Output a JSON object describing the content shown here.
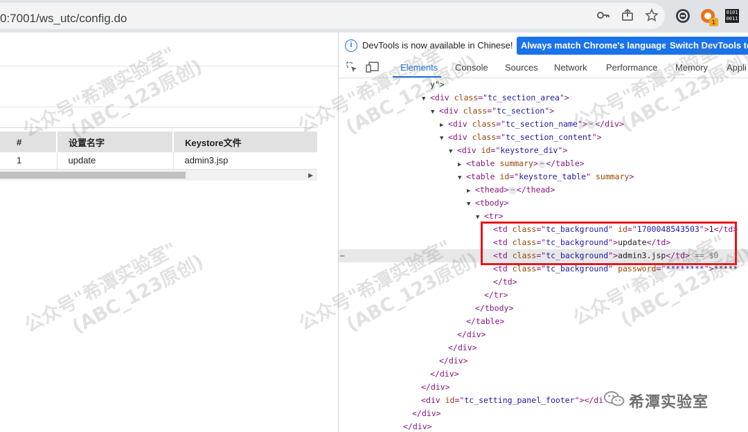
{
  "browser": {
    "url": "0:7001/ws_utc/config.do",
    "extension_badge": "1",
    "extension_binary_text": "0101 0011"
  },
  "page": {
    "table": {
      "headers": [
        "#",
        "设置名字",
        "Keystore文件"
      ],
      "rows": [
        [
          "1",
          "update",
          "admin3.jsp"
        ]
      ]
    },
    "scroll_arrow": "▶"
  },
  "devtools": {
    "infobar": {
      "text": "DevTools is now available in Chinese!",
      "match_button": "Always match Chrome's language",
      "switch_button": "Switch DevTools to"
    },
    "tabs": [
      "Elements",
      "Console",
      "Sources",
      "Network",
      "Performance",
      "Memory",
      "Appli"
    ],
    "active_tab": "Elements",
    "row_more": "⋯",
    "dom_lines": [
      {
        "indent": 0,
        "tri": "",
        "parts": [
          [
            "tx",
            "y\">"
          ]
        ]
      },
      {
        "indent": 0,
        "tri": "▼",
        "parts": [
          [
            "tg",
            "<div "
          ],
          [
            "an",
            "class"
          ],
          [
            "tg",
            "=\""
          ],
          [
            "av",
            "tc_section_area"
          ],
          [
            "tg",
            "\">"
          ]
        ]
      },
      {
        "indent": 1,
        "tri": "▼",
        "parts": [
          [
            "tg",
            "<div "
          ],
          [
            "an",
            "class"
          ],
          [
            "tg",
            "=\""
          ],
          [
            "av",
            "tc_section"
          ],
          [
            "tg",
            "\">"
          ]
        ]
      },
      {
        "indent": 2,
        "tri": "▶",
        "parts": [
          [
            "tg",
            "<div "
          ],
          [
            "an",
            "class"
          ],
          [
            "tg",
            "=\""
          ],
          [
            "av",
            "tc_section_name"
          ],
          [
            "tg",
            "\">"
          ],
          [
            "ell",
            "⋯"
          ],
          [
            "tg",
            "</div>"
          ]
        ]
      },
      {
        "indent": 2,
        "tri": "▼",
        "parts": [
          [
            "tg",
            "<div "
          ],
          [
            "an",
            "class"
          ],
          [
            "tg",
            "=\""
          ],
          [
            "av",
            "tc_section_content"
          ],
          [
            "tg",
            "\">"
          ]
        ]
      },
      {
        "indent": 3,
        "tri": "▼",
        "parts": [
          [
            "tg",
            "<div "
          ],
          [
            "an",
            "id"
          ],
          [
            "tg",
            "=\""
          ],
          [
            "av",
            "keystore_div"
          ],
          [
            "tg",
            "\">"
          ]
        ]
      },
      {
        "indent": 4,
        "tri": "▶",
        "parts": [
          [
            "tg",
            "<table "
          ],
          [
            "an",
            "summary"
          ],
          [
            "tg",
            ">"
          ],
          [
            "ell",
            "⋯"
          ],
          [
            "tg",
            "</table>"
          ]
        ]
      },
      {
        "indent": 4,
        "tri": "▼",
        "parts": [
          [
            "tg",
            "<table "
          ],
          [
            "an",
            "id"
          ],
          [
            "tg",
            "=\""
          ],
          [
            "av",
            "keystore_table"
          ],
          [
            "tg",
            "\" "
          ],
          [
            "an",
            "summary"
          ],
          [
            "tg",
            ">"
          ]
        ]
      },
      {
        "indent": 5,
        "tri": "▶",
        "parts": [
          [
            "tg",
            "<thead>"
          ],
          [
            "ell",
            "⋯"
          ],
          [
            "tg",
            "</thead>"
          ]
        ]
      },
      {
        "indent": 5,
        "tri": "▼",
        "parts": [
          [
            "tg",
            "<tbody>"
          ]
        ]
      },
      {
        "indent": 6,
        "tri": "▼",
        "parts": [
          [
            "tg",
            "<tr>"
          ]
        ]
      },
      {
        "indent": 7,
        "tri": "",
        "parts": [
          [
            "tg",
            "<td "
          ],
          [
            "an",
            "class"
          ],
          [
            "tg",
            "=\""
          ],
          [
            "av",
            "tc_background"
          ],
          [
            "tg",
            "\" "
          ],
          [
            "an",
            "id"
          ],
          [
            "tg",
            "=\""
          ],
          [
            "av",
            "1700048543503"
          ],
          [
            "tg",
            "\">"
          ],
          [
            "tx",
            "1"
          ],
          [
            "tg",
            "</td>"
          ]
        ]
      },
      {
        "indent": 7,
        "tri": "",
        "parts": [
          [
            "tg",
            "<td "
          ],
          [
            "an",
            "class"
          ],
          [
            "tg",
            "=\""
          ],
          [
            "av",
            "tc_background"
          ],
          [
            "tg",
            "\">"
          ],
          [
            "tx",
            "update"
          ],
          [
            "tg",
            "</td>"
          ]
        ]
      },
      {
        "indent": 7,
        "tri": "",
        "selected": true,
        "parts": [
          [
            "tg",
            "<td "
          ],
          [
            "an",
            "class"
          ],
          [
            "tg",
            "=\""
          ],
          [
            "av",
            "tc_background"
          ],
          [
            "tg",
            "\">"
          ],
          [
            "tx",
            "admin3.jsp"
          ],
          [
            "tg",
            "</td>"
          ],
          [
            "eqvar",
            " == $0"
          ]
        ]
      },
      {
        "indent": 7,
        "tri": "",
        "parts": [
          [
            "tg",
            "<td "
          ],
          [
            "an",
            "class"
          ],
          [
            "tg",
            "=\""
          ],
          [
            "av",
            "tc_background"
          ],
          [
            "tg",
            "\" "
          ],
          [
            "an",
            "password"
          ],
          [
            "tg",
            "=\""
          ],
          [
            "av",
            "********"
          ],
          [
            "tg",
            "\">"
          ],
          [
            "tx",
            "*****"
          ]
        ]
      },
      {
        "indent": 7,
        "tri": "",
        "parts": [
          [
            "tg",
            "</td>"
          ]
        ]
      },
      {
        "indent": 6,
        "tri": "",
        "parts": [
          [
            "tg",
            "</tr>"
          ]
        ]
      },
      {
        "indent": 5,
        "tri": "",
        "parts": [
          [
            "tg",
            "</tbody>"
          ]
        ]
      },
      {
        "indent": 4,
        "tri": "",
        "parts": [
          [
            "tg",
            "</table>"
          ]
        ]
      },
      {
        "indent": 3,
        "tri": "",
        "parts": [
          [
            "tg",
            "</div>"
          ]
        ]
      },
      {
        "indent": 2,
        "tri": "",
        "parts": [
          [
            "tg",
            "</div>"
          ]
        ]
      },
      {
        "indent": 1,
        "tri": "",
        "parts": [
          [
            "tg",
            "</div>"
          ]
        ]
      },
      {
        "indent": 0,
        "tri": "",
        "parts": [
          [
            "tg",
            "</div>"
          ]
        ]
      },
      {
        "indent": -1,
        "tri": "",
        "parts": [
          [
            "tg",
            "</div>"
          ]
        ]
      },
      {
        "indent": -1,
        "tri": "",
        "parts": [
          [
            "tg",
            "<div "
          ],
          [
            "an",
            "id"
          ],
          [
            "tg",
            "=\""
          ],
          [
            "av",
            "tc_setting_panel_footer"
          ],
          [
            "tg",
            "\">"
          ],
          [
            "tg",
            "</di"
          ]
        ]
      },
      {
        "indent": -2,
        "tri": "",
        "parts": [
          [
            "tg",
            "</div>"
          ]
        ]
      },
      {
        "indent": -3,
        "tri": "",
        "parts": [
          [
            "tg",
            "</div>"
          ]
        ]
      }
    ]
  },
  "watermark": {
    "line1": "公众号\"希潭实验室\"",
    "line2": "(ABC_123原创)"
  },
  "brand": {
    "name": "希潭实验室"
  },
  "colors": {
    "devtools_blue": "#1a73e8",
    "highlight_red": "#e8141b",
    "dom_tag": "#881280",
    "dom_attr_name": "#994500",
    "dom_attr_value": "#1a1aa6"
  }
}
